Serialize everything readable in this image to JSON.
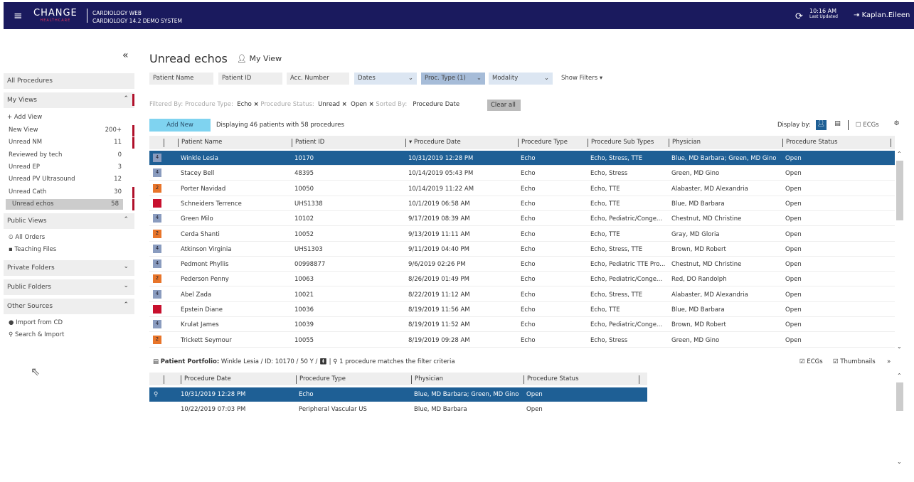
{
  "header": {
    "brand_top": "CHANGE",
    "brand_bottom": "HEALTHCARE",
    "app": "CARDIOLOGY WEB",
    "system": "CARDIOLOGY 14.2 DEMO SYSTEM",
    "time": "10:16 AM",
    "time_label": "Last Updated",
    "user": "Kaplan.Eileen"
  },
  "sidebar": {
    "all": "All Procedures",
    "my_views": "My Views",
    "add_view": "+ Add View",
    "views": [
      {
        "label": "New View",
        "count": "200+",
        "flag": true
      },
      {
        "label": "Unread NM",
        "count": "11",
        "flag": true
      },
      {
        "label": "Reviewed by tech",
        "count": "0",
        "flag": false
      },
      {
        "label": "Unread EP",
        "count": "3",
        "flag": false
      },
      {
        "label": "Unread PV Ultrasound",
        "count": "12",
        "flag": false
      },
      {
        "label": "Unread Cath",
        "count": "30",
        "flag": true
      },
      {
        "label": "Unread echos",
        "count": "58",
        "flag": true
      }
    ],
    "public_views": "Public Views",
    "all_orders": "All Orders",
    "teaching": "Teaching Files",
    "private_folders": "Private Folders",
    "public_folders": "Public Folders",
    "other_sources": "Other Sources",
    "import_cd": "Import from CD",
    "search_import": "Search & Import"
  },
  "main": {
    "title": "Unread echos",
    "my_view": "My View",
    "filters": {
      "patient_name": "Patient Name",
      "patient_id": "Patient ID",
      "acc": "Acc. Number",
      "dates": "Dates",
      "proc_type": "Proc. Type (1)",
      "modality": "Modality",
      "show": "Show Filters"
    },
    "filtered_by": "Filtered By:",
    "f_type_label": "Procedure Type:",
    "f_type": "Echo",
    "f_status_label": "Procedure Status:",
    "f_status1": "Unread",
    "f_status2": "Open",
    "sorted_label": "Sorted By:",
    "sorted": "Procedure Date",
    "clear": "Clear all",
    "add_new": "Add New",
    "displaying": "Displaying 46 patients with 58 procedures",
    "display_by": "Display by:",
    "ecgs": "ECGs",
    "columns": [
      "Patient Name",
      "Patient ID",
      "Procedure Date",
      "Procedure Type",
      "Procedure Sub Types",
      "Physician",
      "Procedure Status"
    ],
    "rows": [
      [
        "4",
        "Winkle Lesia",
        "10170",
        "10/31/2019 12:28 PM",
        "Echo",
        "Echo, Stress, TTE",
        "Blue, MD Barbara; Green, MD Gino",
        "Open"
      ],
      [
        "4",
        "Stacey Bell",
        "48395",
        "10/14/2019 05:43 PM",
        "Echo",
        "Echo, Stress",
        "Green, MD Gino",
        "Open"
      ],
      [
        "2",
        "Porter Navidad",
        "10050",
        "10/14/2019 11:22 AM",
        "Echo",
        "Echo, TTE",
        "Alabaster, MD Alexandria",
        "Open"
      ],
      [
        "1",
        "Schneiders Terrence",
        "UHS1338",
        "10/1/2019 06:58 AM",
        "Echo",
        "Echo, TTE",
        "Blue, MD Barbara",
        "Open"
      ],
      [
        "4",
        "Green Milo",
        "10102",
        "9/17/2019 08:39 AM",
        "Echo",
        "Echo, Pediatric/Conge...",
        "Chestnut, MD Christine",
        "Open"
      ],
      [
        "2",
        "Cerda Shanti",
        "10052",
        "9/13/2019 11:11 AM",
        "Echo",
        "Echo, TTE",
        "Gray, MD Gloria",
        "Open"
      ],
      [
        "4",
        "Atkinson Virginia",
        "UHS1303",
        "9/11/2019 04:40 PM",
        "Echo",
        "Echo, Stress, TTE",
        "Brown, MD Robert",
        "Open"
      ],
      [
        "4",
        "Pedmont Phyllis",
        "00998877",
        "9/6/2019 02:26 PM",
        "Echo",
        "Echo, Pediatric TTE Pro...",
        "Chestnut, MD Christine",
        "Open"
      ],
      [
        "2",
        "Pederson Penny",
        "10063",
        "8/26/2019 01:49 PM",
        "Echo",
        "Echo, Pediatric/Conge...",
        "Red, DO Randolph",
        "Open"
      ],
      [
        "4",
        "Abel Zada",
        "10021",
        "8/22/2019 11:12 AM",
        "Echo",
        "Echo, Stress, TTE",
        "Alabaster, MD Alexandria",
        "Open"
      ],
      [
        "1",
        "Epstein Diane",
        "10036",
        "8/19/2019 11:56 AM",
        "Echo",
        "Echo, TTE",
        "Blue, MD Barbara",
        "Open"
      ],
      [
        "4",
        "Krulat James",
        "10039",
        "8/19/2019 11:52 AM",
        "Echo",
        "Echo, Pediatric/Conge...",
        "Brown, MD Robert",
        "Open"
      ],
      [
        "2",
        "Trickett Seymour",
        "10055",
        "8/19/2019 09:28 AM",
        "Echo",
        "Echo, Stress",
        "Green, MD Gino",
        "Open"
      ]
    ]
  },
  "portfolio": {
    "label": "Patient Portfolio:",
    "info": "Winkle Lesia / ID: 10170 / 50 Y /",
    "match": "1 procedure matches the filter criteria",
    "ecgs": "ECGs",
    "thumbs": "Thumbnails",
    "columns": [
      "Procedure Date",
      "Procedure Type",
      "Physician",
      "Procedure Status"
    ],
    "rows": [
      [
        "10/31/2019 12:28 PM",
        "Echo",
        "Blue, MD Barbara; Green, MD Gino",
        "Open"
      ],
      [
        "10/22/2019 07:03 PM",
        "Peripheral Vascular US",
        "Blue, MD Barbara",
        "Open"
      ]
    ]
  },
  "colors": {
    "header": "#1a1a5e",
    "selected": "#1e5f95",
    "p4": "#8a9cbf",
    "p2": "#e8752a",
    "p1": "#c8102e"
  }
}
